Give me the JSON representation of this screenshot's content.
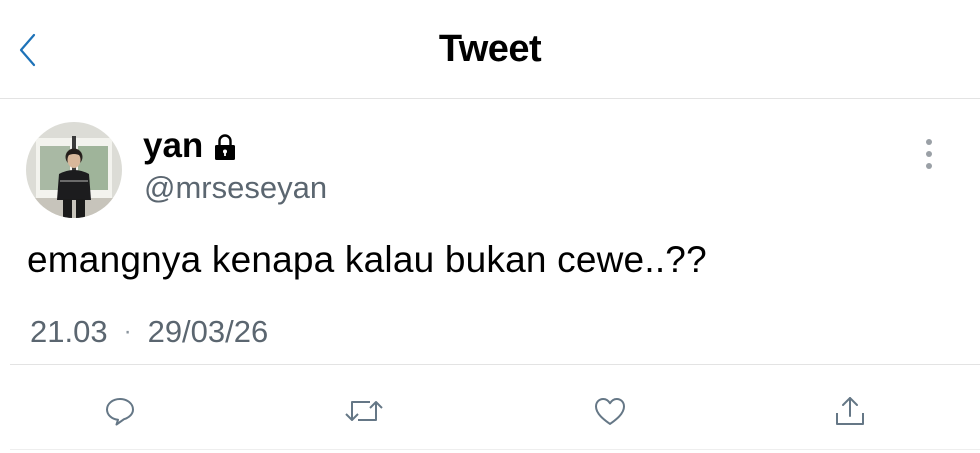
{
  "header": {
    "title": "Tweet",
    "back_icon": "chevron-left-icon"
  },
  "tweet": {
    "author_name": "yan",
    "protected_icon": "lock-icon",
    "handle": "@mrseseyan",
    "text": "emangnya kenapa kalau bukan cewe..??",
    "time": "21.03",
    "separator": "·",
    "date": "29/03/26",
    "more_icon": "vertical-ellipsis-icon"
  },
  "actions": [
    {
      "name": "reply",
      "icon": "speech-bubble-icon"
    },
    {
      "name": "retweet",
      "icon": "retweet-arrows-icon"
    },
    {
      "name": "like",
      "icon": "heart-outline-icon"
    },
    {
      "name": "share",
      "icon": "share-upload-icon"
    }
  ],
  "colors": {
    "accent": "#1da1f2",
    "secondary_text": "#5b6670",
    "icon_gray": "#657786",
    "divider": "#e3e3e3"
  }
}
